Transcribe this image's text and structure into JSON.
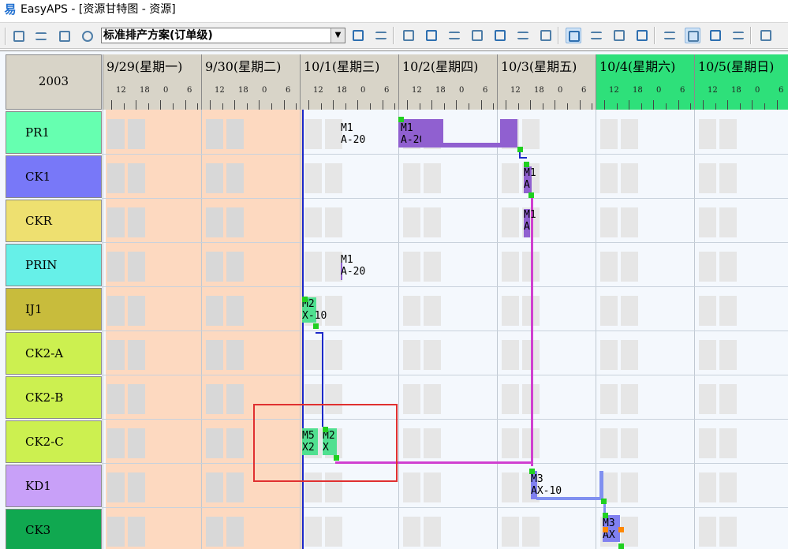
{
  "window": {
    "title": "EasyAPS - [资源甘特图 - 资源]",
    "logo": "易"
  },
  "toolbar": {
    "plan_select_value": "标准排产方案(订单级)",
    "icons_left": [
      "save-icon",
      "print-icon",
      "preview-icon",
      "settings-icon"
    ],
    "icons_right": [
      "refresh-icon",
      "align-icon",
      "copy-icon",
      "indent-icon",
      "filter-icon",
      "list-icon",
      "document-icon",
      "chart-icon",
      "history-icon",
      "gantt-view-icon",
      "zoom-icon",
      "resource-icon",
      "lock-icon",
      "schedule-icon",
      "fit-icon",
      "layers-icon",
      "edit-icon",
      "export-icon"
    ]
  },
  "gantt": {
    "corner_label": "2003",
    "days": [
      {
        "label": "9/29(星期一)",
        "weekend": false
      },
      {
        "label": "9/30(星期二)",
        "weekend": false
      },
      {
        "label": "10/1(星期三)",
        "weekend": false
      },
      {
        "label": "10/2(星期四)",
        "weekend": false
      },
      {
        "label": "10/3(星期五)",
        "weekend": false
      },
      {
        "label": "10/4(星期六)",
        "weekend": true
      },
      {
        "label": "10/5(星期日)",
        "weekend": true
      }
    ],
    "hour_ticks": [
      "12",
      "18",
      "0",
      "6"
    ],
    "resources": [
      {
        "label": "PR1",
        "color": "#66ffb0"
      },
      {
        "label": "CK1",
        "color": "#7878f8"
      },
      {
        "label": "CKR",
        "color": "#eee070"
      },
      {
        "label": "PRIN",
        "color": "#66f0e8"
      },
      {
        "label": "IJ1",
        "color": "#c8bc3c"
      },
      {
        "label": "CK2-A",
        "color": "#ccf050"
      },
      {
        "label": "CK2-B",
        "color": "#ccf050"
      },
      {
        "label": "CK2-C",
        "color": "#ccf050"
      },
      {
        "label": "KD1",
        "color": "#c8a0f8"
      },
      {
        "label": "CK3",
        "color": "#10a850"
      }
    ],
    "tasks": [
      {
        "resource": "PR1",
        "text": "M1\nA-20",
        "color": "#9060d0"
      },
      {
        "resource": "PR1",
        "text": "M1\nA-20",
        "color": "#9060d0"
      },
      {
        "resource": "CK1",
        "text": "M1\nA",
        "color": "#9060d0"
      },
      {
        "resource": "CKR",
        "text": "M1\nA",
        "color": "#9060d0"
      },
      {
        "resource": "PRIN",
        "text": "M1\nA-20",
        "color": "#9060d0"
      },
      {
        "resource": "IJ1",
        "text": "M2\nX-10",
        "color": "#50e090"
      },
      {
        "resource": "CK2-C",
        "text": "M5\nX2",
        "color": "#50e090"
      },
      {
        "resource": "CK2-C",
        "text": "M2\nX",
        "color": "#50e090"
      },
      {
        "resource": "KD1",
        "text": "M3\nAX-10",
        "color": "#8080f0"
      },
      {
        "resource": "CK3",
        "text": "M3\nAX",
        "color": "#8080f0"
      }
    ]
  }
}
